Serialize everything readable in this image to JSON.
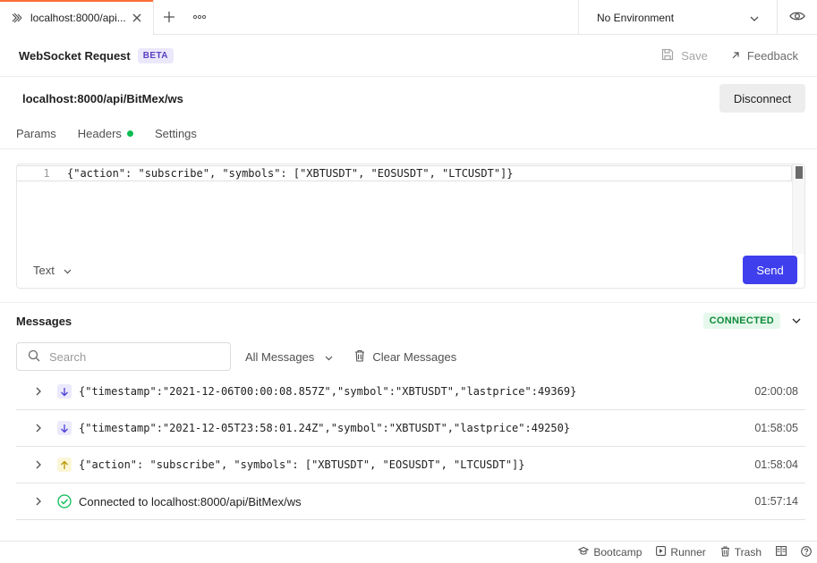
{
  "tab": {
    "label": "localhost:8000/api...",
    "icon": "websocket-icon",
    "close_icon": "close-icon"
  },
  "environment": {
    "selected": "No Environment"
  },
  "request": {
    "title": "WebSocket Request",
    "badge": "BETA",
    "save_label": "Save",
    "feedback_label": "Feedback",
    "url": "localhost:8000/api/BitMex/ws",
    "disconnect_label": "Disconnect"
  },
  "tabs": [
    {
      "label": "Params"
    },
    {
      "label": "Headers"
    },
    {
      "label": "Settings"
    }
  ],
  "editor": {
    "line_number": "1",
    "code": "{\"action\": \"subscribe\", \"symbols\": [\"XBTUSDT\", \"EOSUSDT\", \"LTCUSDT\"]}",
    "format": "Text",
    "send_label": "Send"
  },
  "messages": {
    "title": "Messages",
    "status": "CONNECTED",
    "search_placeholder": "Search",
    "filter": "All Messages",
    "clear_label": "Clear Messages",
    "items": [
      {
        "direction": "incoming",
        "text": "{\"timestamp\":\"2021-12-06T00:00:08.857Z\",\"symbol\":\"XBTUSDT\",\"lastprice\":49369}",
        "time": "02:00:08"
      },
      {
        "direction": "incoming",
        "text": "{\"timestamp\":\"2021-12-05T23:58:01.24Z\",\"symbol\":\"XBTUSDT\",\"lastprice\":49250}",
        "time": "01:58:05"
      },
      {
        "direction": "outgoing",
        "text": "{\"action\": \"subscribe\", \"symbols\": [\"XBTUSDT\", \"EOSUSDT\", \"LTCUSDT\"]}",
        "time": "01:58:04"
      },
      {
        "direction": "connected",
        "text": "Connected to localhost:8000/api/BitMex/ws",
        "time": "01:57:14"
      }
    ]
  },
  "statusbar": {
    "bootcamp": "Bootcamp",
    "runner": "Runner",
    "trash": "Trash"
  },
  "colors": {
    "accent": "#ff6c37",
    "send_button": "#3f3fee",
    "connected_green": "#0cbb52",
    "beta_text": "#5a3fc4"
  }
}
